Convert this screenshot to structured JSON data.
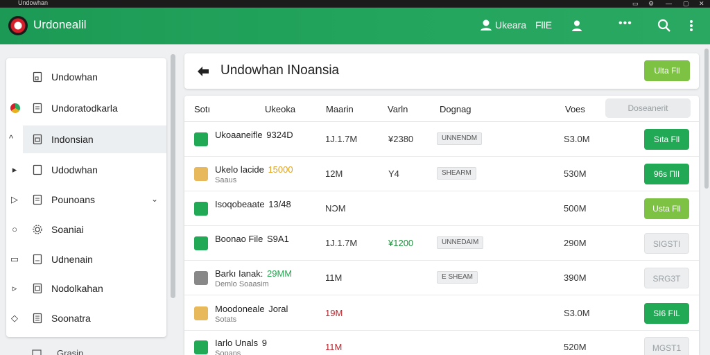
{
  "window": {
    "title": "Undowhan"
  },
  "topbar": {
    "app_title": "Urdonealil",
    "user_name": "Ukeara",
    "file_link": "FllE",
    "more_dots": "•••"
  },
  "sidebar": {
    "items": [
      {
        "label": "Undowhan",
        "lead": ""
      },
      {
        "label": "Undoratodkarla",
        "lead": ""
      },
      {
        "label": "Indonsian",
        "lead": "^"
      },
      {
        "label": "Udodwhan",
        "lead": "▸"
      },
      {
        "label": "Pounoans",
        "lead": "▷",
        "chevron": "⌄"
      },
      {
        "label": "Soaniai",
        "lead": "○"
      },
      {
        "label": "Udnenain",
        "lead": "▭"
      },
      {
        "label": "Nodolkahan",
        "lead": "▹"
      },
      {
        "label": "Soonatra",
        "lead": "◇"
      }
    ],
    "footer_label": "Grasin"
  },
  "header": {
    "page_title": "Undowhan INoansia",
    "primary_button": "Ulta Fll"
  },
  "table": {
    "columns": [
      "Sotı",
      "Ukeoka",
      "Maarin",
      "Varln",
      "Dognag",
      "Voes"
    ],
    "filter_button": "Doseanerit",
    "rows": [
      {
        "name": "Ukoaaneifle",
        "name_hl": "9324D",
        "sub": "",
        "c1": "1J.1.7M",
        "c2": "¥2380",
        "c2_color": "#333333",
        "tag": "UNNENDM",
        "size": "S3.0M",
        "action": "Sıta Fll",
        "action_style": "green",
        "icon_color": "#21a956"
      },
      {
        "name": "Ukelo lacide",
        "name_hl": "15000",
        "sub": "Saaus",
        "c1": "12M",
        "c2": "Y4",
        "c2_color": "#333333",
        "tag": "SHEARM",
        "size": "530M",
        "action": "96s ΠlI",
        "action_style": "green",
        "icon_color": "#e8b95a",
        "hl_color": "#e0a020"
      },
      {
        "name": "Isoqobeaate",
        "name_hl": "13/48",
        "sub": "",
        "c1": "NƆM",
        "c2": "",
        "c2_color": "#333333",
        "tag": "",
        "size": "500M",
        "action": "Usta Fll",
        "action_style": "lime",
        "icon_color": "#21a956"
      },
      {
        "name": "Boonao File",
        "name_hl": "S9A1",
        "sub": "",
        "c1": "1J.1.7M",
        "c2": "¥1200",
        "c2_color": "#1e8f3e",
        "tag": "UNNEDAIM",
        "size": "290M",
        "action": "SIGSTI",
        "action_style": "grey",
        "icon_color": "#21a956"
      },
      {
        "name": "Barkı Ianak:",
        "name_hl": "29MM",
        "sub": "Demlo Soaasim",
        "c1": "11M",
        "c2": "",
        "c2_color": "#333333",
        "tag": "E SHEAM",
        "size": "390M",
        "action": "SRG3T",
        "action_style": "grey",
        "icon_color": "#888888",
        "hl_color": "#22a84f"
      },
      {
        "name": "Moodoneale",
        "name_hl": "Joral",
        "sub": "Sotats",
        "c1": "19M",
        "c1_color": "#b8242c",
        "c2": "",
        "c2_color": "#333333",
        "tag": "",
        "size": "S3.0M",
        "action": "SI6 FIL",
        "action_style": "green",
        "icon_color": "#e8b95a"
      },
      {
        "name": "Iarlo Unals",
        "name_hl": "9",
        "sub": "Sopans",
        "c1": "11M",
        "c1_color": "#b8242c",
        "c2": "",
        "c2_color": "#333333",
        "tag": "",
        "size": "520M",
        "action": "MGST1",
        "action_style": "grey",
        "icon_color": "#21a956"
      }
    ]
  },
  "colors": {
    "topbar_green": "#23a55d",
    "action_green": "#21a956",
    "action_lime": "#7dc242",
    "alert_red": "#b8242c"
  }
}
